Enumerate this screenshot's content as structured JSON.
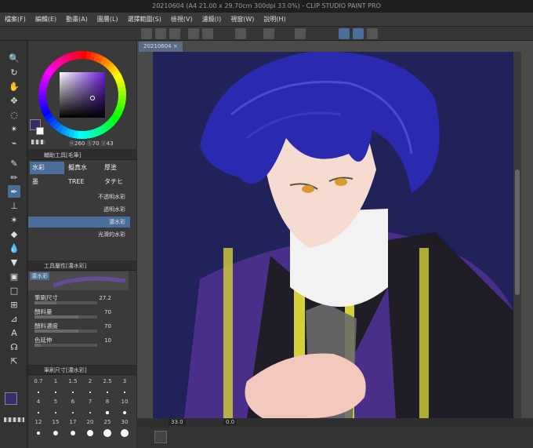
{
  "title": "20210604 (A4 21.00 x 29.70cm 300dpi 33.0%) - CLIP STUDIO PAINT PRO",
  "menu": [
    "檔案(F)",
    "編輯(E)",
    "動畫(A)",
    "圖層(L)",
    "選擇範圍(S)",
    "檢視(V)",
    "濾鏡(I)",
    "視窗(W)",
    "說明(H)"
  ],
  "color": {
    "sv_readout": "260",
    "s_readout": "70",
    "v_readout": "43",
    "main_color": "#3a2a6e",
    "sub_color": "#ffffff"
  },
  "subtool": {
    "header": "輔助工具[毛筆]",
    "tabs": [
      "水彩",
      "擬真水",
      "厚塗",
      "墨",
      "TREE",
      "タチヒ"
    ],
    "brushes": [
      "不透明水彩",
      "透明水彩",
      "濃水彩",
      "光滑的水彩"
    ],
    "selected_brush_index": 2
  },
  "tool_property": {
    "header": "工具屬性[濃水彩]",
    "preview_label": "濃水彩",
    "props": [
      {
        "label": "筆刷尺寸",
        "value": "27.2",
        "fill": 0.35
      },
      {
        "label": "顏料量",
        "value": "70",
        "fill": 0.7
      },
      {
        "label": "顏料濃度",
        "value": "70",
        "fill": 0.7
      },
      {
        "label": "色延伸",
        "value": "10",
        "fill": 0.1
      }
    ]
  },
  "brush_size": {
    "header": "筆刷尺寸[濃水彩]",
    "sizes": [
      "0.7",
      "1",
      "1.5",
      "2",
      "2.5",
      "3",
      "4",
      "5",
      "6",
      "7",
      "8",
      "10",
      "12",
      "15",
      "17",
      "20",
      "25",
      "30"
    ]
  },
  "document": {
    "tab_label": "20210604",
    "zoom": "33.0",
    "angle": "0.0"
  }
}
